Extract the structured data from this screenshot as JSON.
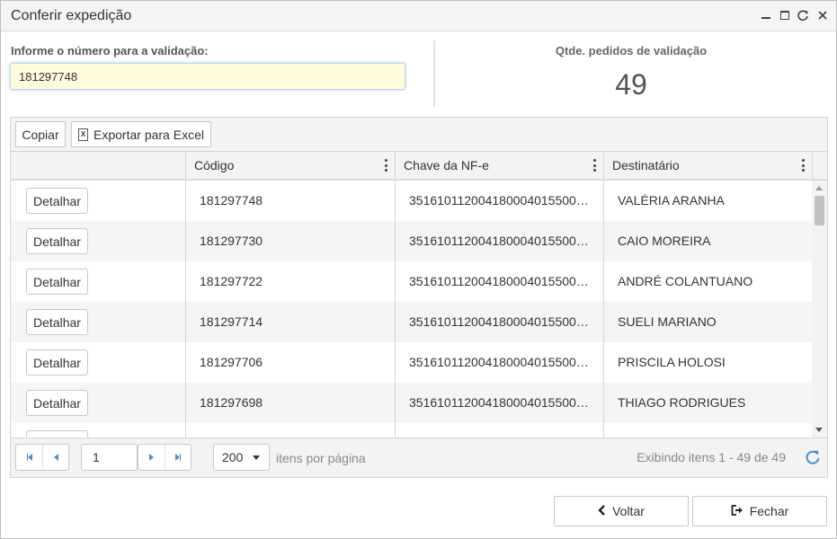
{
  "window": {
    "title": "Conferir expedição",
    "controls": [
      "minimize",
      "maximize",
      "refresh",
      "close"
    ]
  },
  "validation": {
    "label": "Informe o número para a validação:",
    "value": "181297748",
    "placeholder": ""
  },
  "summary": {
    "label": "Qtde. pedidos de validação",
    "value": "49"
  },
  "toolbar": {
    "copy_label": "Copiar",
    "export_label": "Exportar para Excel"
  },
  "columns": [
    "",
    "Código",
    "Chave da NF-e",
    "Destinatário"
  ],
  "rows": [
    {
      "action": "Detalhar",
      "codigo": "181297748",
      "chave": "351610112004180004015500…",
      "destinatario": "VALÉRIA ARANHA"
    },
    {
      "action": "Detalhar",
      "codigo": "181297730",
      "chave": "351610112004180004015500…",
      "destinatario": "CAIO MOREIRA"
    },
    {
      "action": "Detalhar",
      "codigo": "181297722",
      "chave": "351610112004180004015500…",
      "destinatario": "ANDRÉ COLANTUANO"
    },
    {
      "action": "Detalhar",
      "codigo": "181297714",
      "chave": "351610112004180004015500…",
      "destinatario": "SUELI MARIANO"
    },
    {
      "action": "Detalhar",
      "codigo": "181297706",
      "chave": "351610112004180004015500…",
      "destinatario": "PRISCILA HOLOSI"
    },
    {
      "action": "Detalhar",
      "codigo": "181297698",
      "chave": "351610112004180004015500…",
      "destinatario": "THIAGO RODRIGUES"
    }
  ],
  "pager": {
    "page": "1",
    "page_size": "200",
    "page_size_label": "itens por página",
    "info": "Exibindo itens 1 - 49 de 49"
  },
  "footer": {
    "back_label": "Voltar",
    "close_label": "Fechar"
  },
  "colors": {
    "accent": "#4a8fd0",
    "input_bg": "#fffbdc",
    "alt_row": "#f5f5f5"
  }
}
